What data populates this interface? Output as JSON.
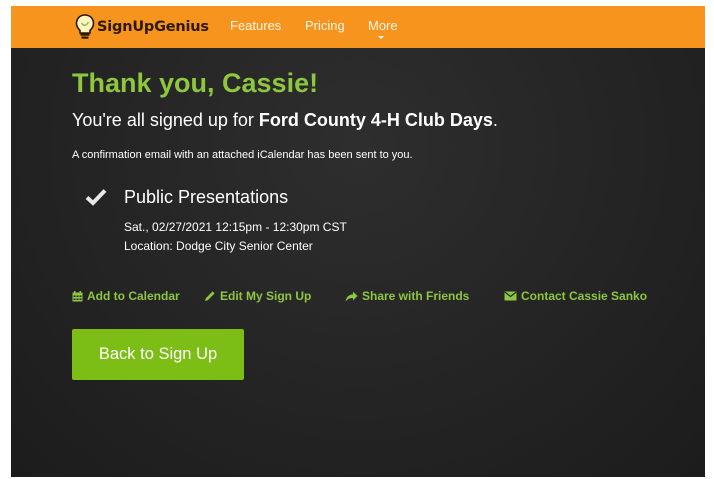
{
  "nav": {
    "logo_text": "SignUpGenius",
    "items": [
      "Features",
      "Pricing",
      "More"
    ]
  },
  "confirmation": {
    "title": "Thank you, Cassie!",
    "subtitle_prefix": "You're all signed up for ",
    "event_name": "Ford County 4-H Club Days",
    "subtitle_suffix": ".",
    "email_note": "A confirmation email with an attached iCalendar has been sent to you."
  },
  "slot": {
    "name": "Public Presentations",
    "datetime": "Sat., 02/27/2021 12:15pm - 12:30pm CST",
    "location": "Location: Dodge City Senior Center"
  },
  "actions": [
    {
      "label": "Add to Calendar",
      "icon": "calendar-icon"
    },
    {
      "label": "Edit My Sign Up",
      "icon": "pencil-icon"
    },
    {
      "label": "Share with Friends",
      "icon": "share-arrow-icon"
    },
    {
      "label": "Contact Cassie Sanko",
      "icon": "envelope-icon"
    }
  ],
  "back_button": {
    "label": "Back to Sign Up"
  },
  "colors": {
    "brand_orange": "#f7941d",
    "accent_green": "#8dc63f",
    "button_green": "#7cbd16",
    "background": "#262626"
  }
}
